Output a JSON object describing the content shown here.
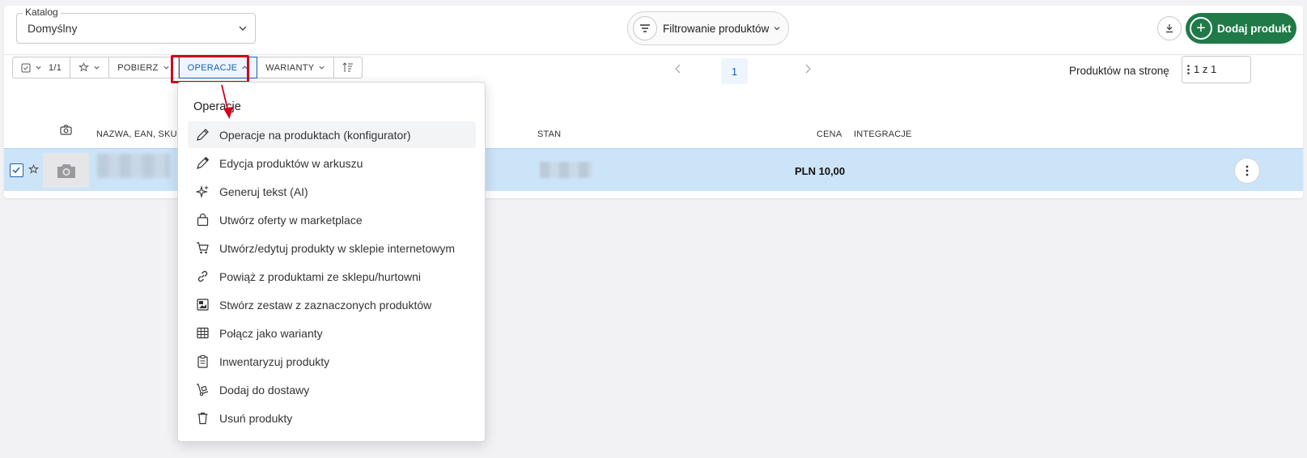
{
  "header": {
    "catalog_label": "Katalog",
    "catalog_value": "Domyślny",
    "filter_label": "Filtrowanie produktów",
    "add_product_label": "Dodaj produkt"
  },
  "toolbar": {
    "selection_count": "1/1",
    "pobierz_label": "POBIERZ",
    "operacje_label": "OPERACJE",
    "warianty_label": "WARIANTY"
  },
  "pagination": {
    "current_page": "1",
    "per_page_label": "Produktów na stronę",
    "per_page_value": "1 z 1"
  },
  "table": {
    "columns": {
      "name": "NAZWA, EAN, SKU, A",
      "stan": "STAN",
      "cena": "CENA",
      "integracje": "INTEGRACJE"
    },
    "row": {
      "price": "PLN 10,00"
    }
  },
  "menu": {
    "title": "Operacje",
    "items": [
      {
        "label": "Operacje na produktach (konfigurator)",
        "icon": "pencil-icon"
      },
      {
        "label": "Edycja produktów w arkuszu",
        "icon": "pen-icon"
      },
      {
        "label": "Generuj tekst (AI)",
        "icon": "sparkles-icon"
      },
      {
        "label": "Utwórz oferty w marketplace",
        "icon": "shopping-bag-icon"
      },
      {
        "label": "Utwórz/edytuj produkty w sklepie internetowym",
        "icon": "cart-icon"
      },
      {
        "label": "Powiąż z produktami ze sklepu/hurtowni",
        "icon": "link-icon"
      },
      {
        "label": "Stwórz zestaw z zaznaczonych produktów",
        "icon": "bundle-icon"
      },
      {
        "label": "Połącz jako warianty",
        "icon": "grid-icon"
      },
      {
        "label": "Inwentaryzuj produkty",
        "icon": "clipboard-icon"
      },
      {
        "label": "Dodaj do dostawy",
        "icon": "hand-truck-icon"
      },
      {
        "label": "Usuń produkty",
        "icon": "trash-icon"
      }
    ]
  },
  "colors": {
    "accent": "#1a5fb4",
    "brand_green": "#1f7a47",
    "highlight_red": "#d0021b",
    "selected_row": "#cce4f8"
  }
}
